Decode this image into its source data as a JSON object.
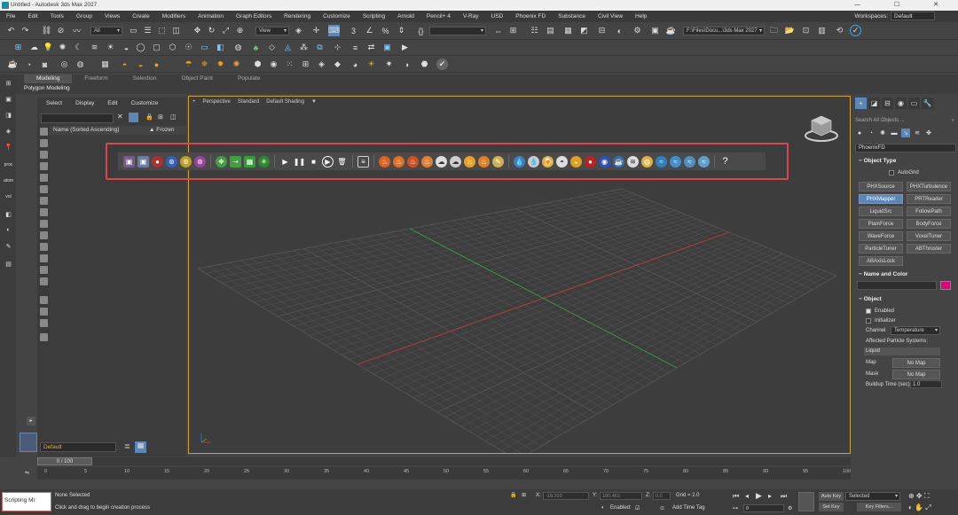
{
  "titlebar": {
    "title": "Untitled - Autodesk 3ds Max 2027",
    "win_controls": "— ☐ ✕"
  },
  "menu": [
    "File",
    "Edit",
    "Tools",
    "Group",
    "Views",
    "Create",
    "Modifiers",
    "Animation",
    "Graph Editors",
    "Rendering",
    "Customize",
    "Scripting",
    "Arnold",
    "Pencil+ 4",
    "V-Ray",
    "USD",
    "Phoenix FD",
    "Substance",
    "Civil View",
    "Help"
  ],
  "workspace": {
    "label": "Workspaces:",
    "value": "Default"
  },
  "toolbar1": {
    "selection_filter": "All",
    "ref_coord": "View",
    "project_path": "F:\\Files\\Docu...\\3ds Max 2027"
  },
  "ribbon": {
    "tabs": [
      "Modeling",
      "Freeform",
      "Selection",
      "Object Paint",
      "Populate"
    ],
    "active": "Modeling",
    "subtitle": "Polygon Modeling"
  },
  "left_labels": [
    "proc",
    "atom",
    "vol"
  ],
  "scene_explorer": {
    "menu": [
      "Select",
      "Display",
      "Edit",
      "Customize"
    ],
    "column": "Name (Sorted Ascending)",
    "frozen": "▲ Frozen"
  },
  "layer": {
    "value": "Default"
  },
  "viewport": {
    "labels": [
      "+",
      "Perspective",
      "Standard",
      "Default Shading",
      "▼"
    ]
  },
  "phoenix_toolbar": {
    "icons": [
      "phx-source-icon",
      "phx-mapper-icon",
      "particle-icon",
      "vortex-icon",
      "force-icon",
      "turbulence-icon",
      "move-icon",
      "transform-icon",
      "voxel-icon",
      "burst-icon",
      "play-icon",
      "pause-icon",
      "stop-icon",
      "resume-icon",
      "delete-icon",
      "list-icon",
      "fire-icon",
      "fire-icon",
      "fire-icon",
      "fire-icon",
      "smoke-icon",
      "smoke-icon",
      "fire-icon",
      "fire-icon",
      "brush-icon",
      "liquid-icon",
      "liquid-icon",
      "cup-icon",
      "pot-icon",
      "bowl-icon",
      "lava-icon",
      "sphere-icon",
      "coffee-icon",
      "wave-icon",
      "splash-icon",
      "ocean-icon",
      "ocean-icon",
      "ocean-icon",
      "ocean-icon",
      "help-icon"
    ]
  },
  "command_panel": {
    "search_placeholder": "Search All Objects ...",
    "category": "PhoenixFD",
    "object_type": {
      "title": "Object Type",
      "autogrid": "AutoGrid",
      "buttons": [
        "PHXSource",
        "PHXTurbulence",
        "PHXMapper",
        "PRTReader",
        "LiquidSrc",
        "FollowPath",
        "PlainForce",
        "BodyForce",
        "WaveForce",
        "VoxelTuner",
        "ParticleTuner",
        "ABThruster",
        "ABAxisLock"
      ],
      "selected": "PHXMapper"
    },
    "name_color": {
      "title": "Name and Color",
      "swatch": "#e0007a"
    },
    "object": {
      "title": "Object",
      "enabled": "Enabled",
      "initializer": "Initializer",
      "channel_label": "Channel",
      "channel": "Temperature",
      "affected": "Affected Particle Systems:",
      "liquid": "Liquid",
      "map_label": "Map",
      "map_btn": "No Map",
      "mask_label": "Mask",
      "mask_btn": "No Map",
      "buildup_label": "Buildup Time (sec)",
      "buildup": "1.0"
    }
  },
  "time": {
    "slider": "0 / 100",
    "ticks": [
      "0",
      "5",
      "10",
      "15",
      "20",
      "25",
      "30",
      "35",
      "40",
      "45",
      "50",
      "55",
      "60",
      "65",
      "70",
      "75",
      "80",
      "85",
      "90",
      "95",
      "100"
    ]
  },
  "status": {
    "script": "Scripting Mi:",
    "none_selected": "None Selected",
    "prompt": "Click and drag to begin creation process",
    "x_label": "X:",
    "x_val": "-19.203",
    "y_label": "Y:",
    "y_val": "180.463",
    "z_label": "Z:",
    "z_val": "0.0",
    "grid": "Grid = 2.0",
    "enabled": "Enabled:",
    "add_time_tag": "Add Time Tag",
    "auto_key": "Auto Key",
    "selected": "Selected",
    "set_key": "Set Key",
    "key_filters": "Key Filters...",
    "frame": "0"
  },
  "colors": {
    "accent": "#5a87b8",
    "viewport_border": "#c8a43a",
    "highlight": "#d9474a"
  }
}
